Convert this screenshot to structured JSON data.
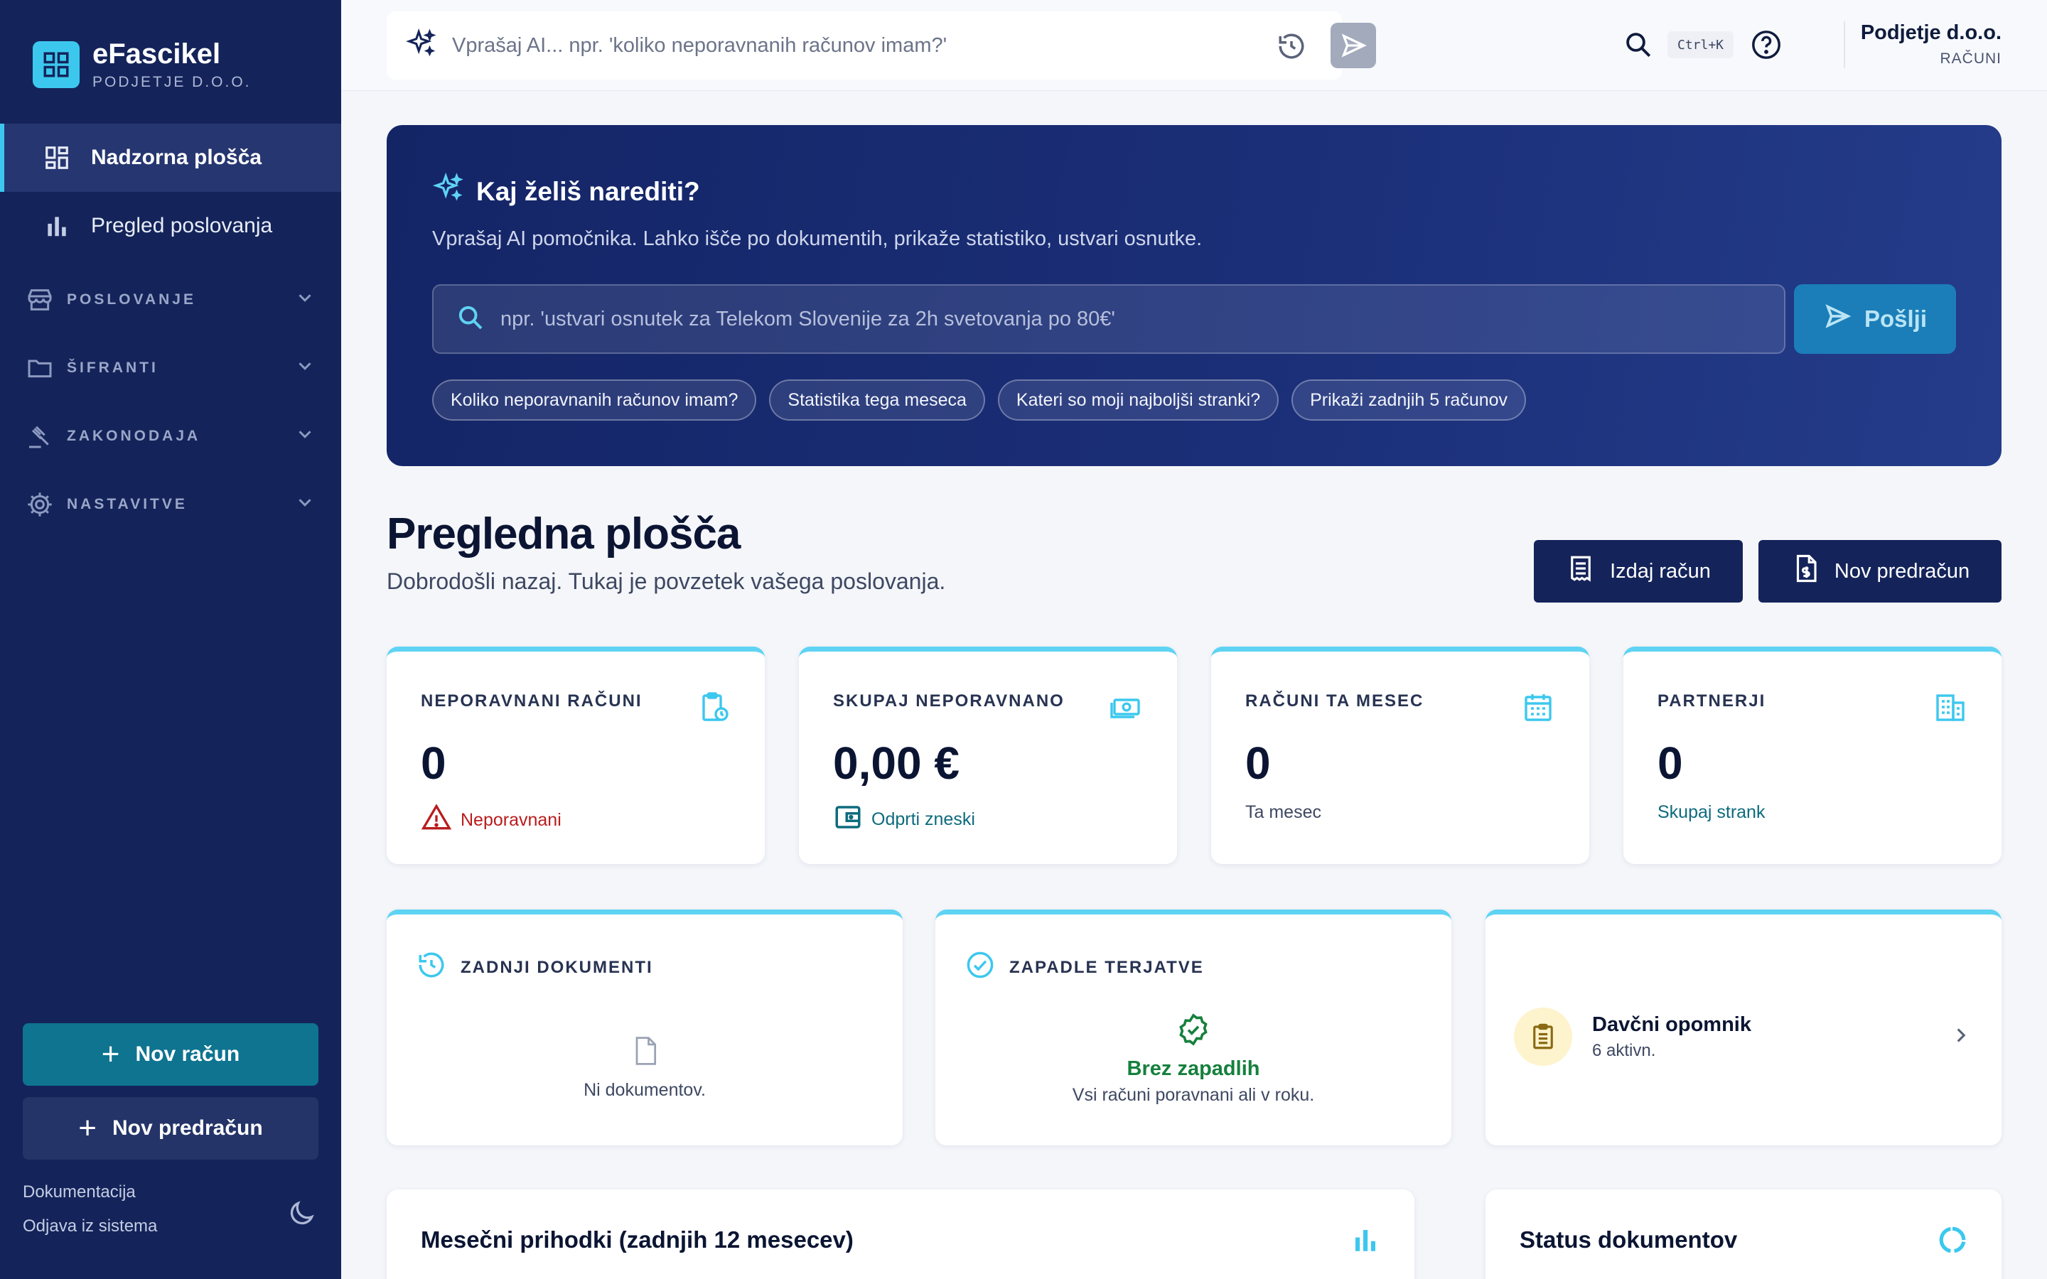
{
  "brand": {
    "name": "eFascikel",
    "subtitle": "PODJETJE D.O.O."
  },
  "sidebar": {
    "items": [
      {
        "label": "Nadzorna plošča",
        "icon": "dashboard-icon",
        "active": true
      },
      {
        "label": "Pregled poslovanja",
        "icon": "bar-chart-icon",
        "active": false
      }
    ],
    "sections": [
      {
        "label": "POSLOVANJE",
        "icon": "store-icon"
      },
      {
        "label": "ŠIFRANTI",
        "icon": "folder-icon"
      },
      {
        "label": "ZAKONODAJA",
        "icon": "gavel-icon"
      },
      {
        "label": "NASTAVITVE",
        "icon": "gear-icon"
      }
    ],
    "new_invoice": "Nov račun",
    "new_proforma": "Nov predračun",
    "docs_link": "Dokumentacija",
    "logout_link": "Odjava iz sistema"
  },
  "topbar": {
    "ai_placeholder": "Vprašaj AI... npr. 'koliko neporavnanih računov imam?'",
    "shortcut": "Ctrl+K",
    "company_name": "Podjetje d.o.o.",
    "company_role": "RAČUNI"
  },
  "hero": {
    "title": "Kaj želiš narediti?",
    "subtitle": "Vprašaj AI pomočnika. Lahko išče po dokumentih, prikaže statistiko, ustvari osnutke.",
    "placeholder": "npr. 'ustvari osnutek za Telekom Slovenije za 2h svetovanja po 80€'",
    "send_label": "Pošlji",
    "chips": [
      "Koliko neporavnanih računov imam?",
      "Statistika tega meseca",
      "Kateri so moji najboljši stranki?",
      "Prikaži zadnjih 5 računov"
    ]
  },
  "page": {
    "title": "Pregledna plošča",
    "subtitle": "Dobrodošli nazaj. Tukaj je povzetek vašega poslovanja.",
    "issue_invoice": "Izdaj račun",
    "new_proforma": "Nov predračun"
  },
  "stats": [
    {
      "label": "NEPORAVNANI RAČUNI",
      "value": "0",
      "note": "Neporavnani",
      "note_color": "#b91c1c",
      "icon": "clipboard-clock-icon"
    },
    {
      "label": "SKUPAJ NEPORAVNANO",
      "value": "0,00 €",
      "note": "Odprti zneski",
      "note_color": "#0e6b7d",
      "icon": "money-icon"
    },
    {
      "label": "RAČUNI TA MESEC",
      "value": "0",
      "note": "Ta mesec",
      "note_color": "#3e4862",
      "icon": "calendar-icon"
    },
    {
      "label": "PARTNERJI",
      "value": "0",
      "note": "Skupaj strank",
      "note_color": "#0e6b7d",
      "icon": "building-icon"
    }
  ],
  "recent_docs": {
    "title": "ZADNJI DOKUMENTI",
    "empty": "Ni dokumentov."
  },
  "overdue": {
    "title": "ZAPADLE TERJATVE",
    "status": "Brez zapadlih",
    "detail": "Vsi računi poravnani ali v roku."
  },
  "tax_reminder": {
    "title": "Davčni opomnik",
    "count_text": "6 aktivn."
  },
  "monthly_income": {
    "title": "Mesečni prihodki (zadnjih 12 mesecev)"
  },
  "doc_status": {
    "title": "Status dokumentov"
  },
  "colors": {
    "sidebar": "#14245a",
    "accent": "#3cc8ee",
    "teal": "#0e7490",
    "success": "#15803d",
    "danger": "#b91c1c"
  }
}
